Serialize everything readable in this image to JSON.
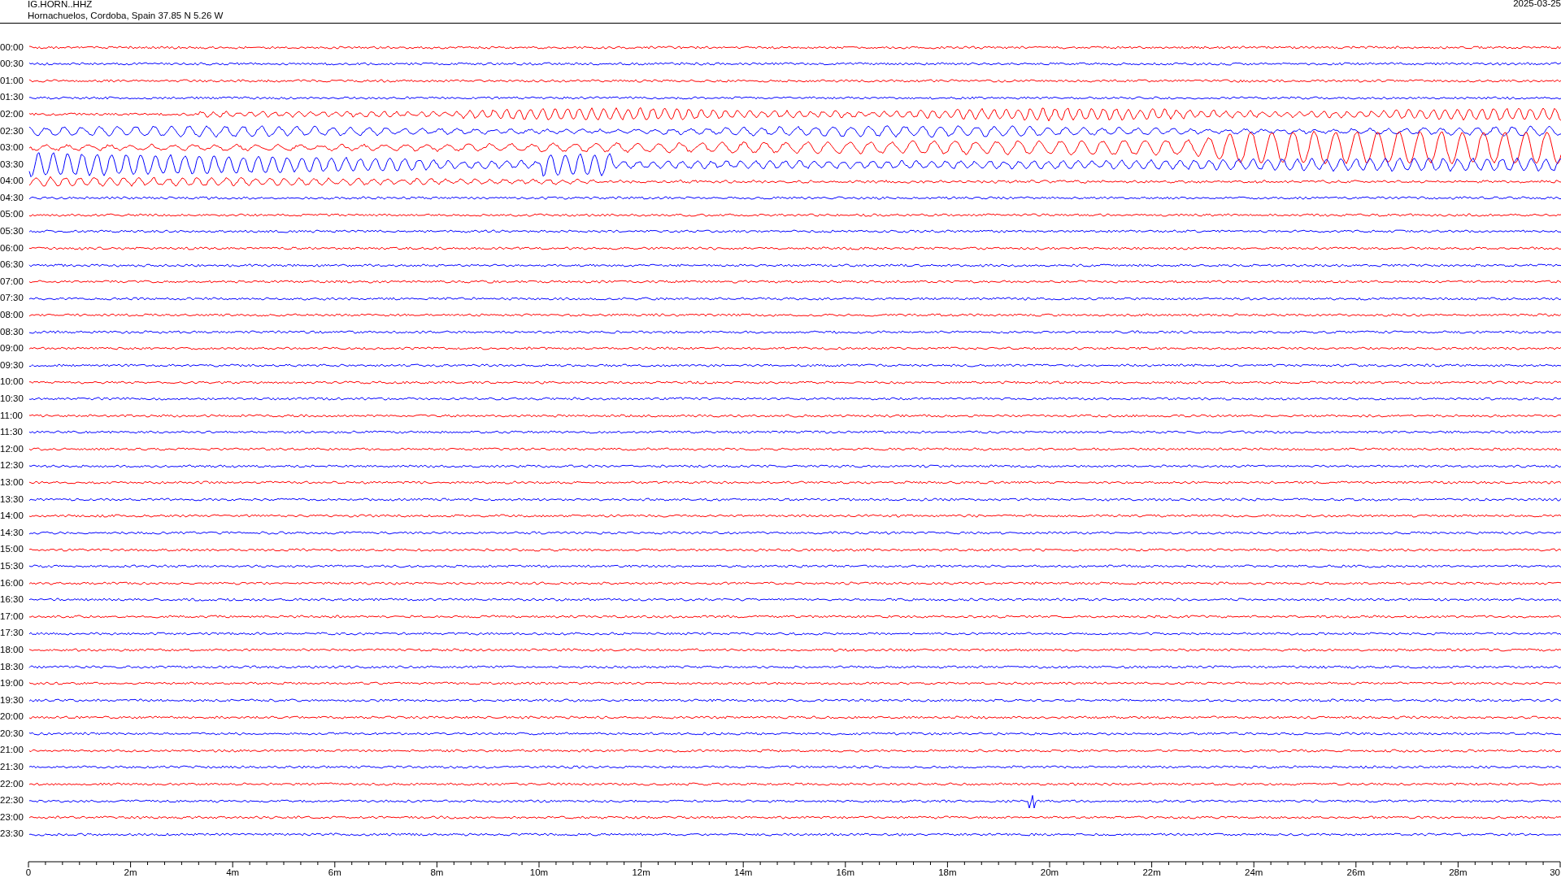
{
  "header": {
    "station": "IG.HORN..HHZ",
    "location": "Hornachuelos, Cordoba, Spain  37.85 N 5.26 W",
    "date": "2025-03-25"
  },
  "traces": [
    {
      "time": "00:00",
      "color": "#ff0000",
      "kind": "quiet"
    },
    {
      "time": "00:30",
      "color": "#0000ff",
      "kind": "quiet"
    },
    {
      "time": "01:00",
      "color": "#ff0000",
      "kind": "quiet"
    },
    {
      "time": "01:30",
      "color": "#0000ff",
      "kind": "quiet"
    },
    {
      "time": "02:00",
      "color": "#ff0000",
      "kind": "onset"
    },
    {
      "time": "02:30",
      "color": "#0000ff",
      "kind": "ripple"
    },
    {
      "time": "03:00",
      "color": "#ff0000",
      "kind": "rising"
    },
    {
      "time": "03:30",
      "color": "#0000ff",
      "kind": "surge"
    },
    {
      "time": "04:00",
      "color": "#ff0000",
      "kind": "fading"
    },
    {
      "time": "04:30",
      "color": "#0000ff",
      "kind": "quiet"
    },
    {
      "time": "05:00",
      "color": "#ff0000",
      "kind": "quiet"
    },
    {
      "time": "05:30",
      "color": "#0000ff",
      "kind": "quiet"
    },
    {
      "time": "06:00",
      "color": "#ff0000",
      "kind": "quiet"
    },
    {
      "time": "06:30",
      "color": "#0000ff",
      "kind": "quiet"
    },
    {
      "time": "07:00",
      "color": "#ff0000",
      "kind": "quiet"
    },
    {
      "time": "07:30",
      "color": "#0000ff",
      "kind": "quiet"
    },
    {
      "time": "08:00",
      "color": "#ff0000",
      "kind": "quiet"
    },
    {
      "time": "08:30",
      "color": "#0000ff",
      "kind": "quiet"
    },
    {
      "time": "09:00",
      "color": "#ff0000",
      "kind": "quiet"
    },
    {
      "time": "09:30",
      "color": "#0000ff",
      "kind": "quiet"
    },
    {
      "time": "10:00",
      "color": "#ff0000",
      "kind": "quiet"
    },
    {
      "time": "10:30",
      "color": "#0000ff",
      "kind": "quiet"
    },
    {
      "time": "11:00",
      "color": "#ff0000",
      "kind": "quiet"
    },
    {
      "time": "11:30",
      "color": "#0000ff",
      "kind": "quiet"
    },
    {
      "time": "12:00",
      "color": "#ff0000",
      "kind": "quiet"
    },
    {
      "time": "12:30",
      "color": "#0000ff",
      "kind": "quiet"
    },
    {
      "time": "13:00",
      "color": "#ff0000",
      "kind": "quiet"
    },
    {
      "time": "13:30",
      "color": "#0000ff",
      "kind": "quiet"
    },
    {
      "time": "14:00",
      "color": "#ff0000",
      "kind": "quiet"
    },
    {
      "time": "14:30",
      "color": "#0000ff",
      "kind": "quiet"
    },
    {
      "time": "15:00",
      "color": "#ff0000",
      "kind": "quiet"
    },
    {
      "time": "15:30",
      "color": "#0000ff",
      "kind": "quiet"
    },
    {
      "time": "16:00",
      "color": "#ff0000",
      "kind": "quiet"
    },
    {
      "time": "16:30",
      "color": "#0000ff",
      "kind": "quiet"
    },
    {
      "time": "17:00",
      "color": "#ff0000",
      "kind": "quiet"
    },
    {
      "time": "17:30",
      "color": "#0000ff",
      "kind": "quiet"
    },
    {
      "time": "18:00",
      "color": "#ff0000",
      "kind": "quiet"
    },
    {
      "time": "18:30",
      "color": "#0000ff",
      "kind": "quiet"
    },
    {
      "time": "19:00",
      "color": "#ff0000",
      "kind": "quiet"
    },
    {
      "time": "19:30",
      "color": "#0000ff",
      "kind": "quiet"
    },
    {
      "time": "20:00",
      "color": "#ff0000",
      "kind": "quiet"
    },
    {
      "time": "20:30",
      "color": "#0000ff",
      "kind": "quiet"
    },
    {
      "time": "21:00",
      "color": "#ff0000",
      "kind": "quiet"
    },
    {
      "time": "21:30",
      "color": "#0000ff",
      "kind": "quiet"
    },
    {
      "time": "22:00",
      "color": "#ff0000",
      "kind": "quiet"
    },
    {
      "time": "22:30",
      "color": "#0000ff",
      "kind": "spike"
    },
    {
      "time": "23:00",
      "color": "#ff0000",
      "kind": "quiet"
    },
    {
      "time": "23:30",
      "color": "#0000ff",
      "kind": "quiet"
    }
  ],
  "time_axis": {
    "labels": [
      "0",
      "2m",
      "4m",
      "6m",
      "8m",
      "10m",
      "12m",
      "14m",
      "16m",
      "18m",
      "20m",
      "22m",
      "24m",
      "26m",
      "28m",
      "30"
    ]
  }
}
